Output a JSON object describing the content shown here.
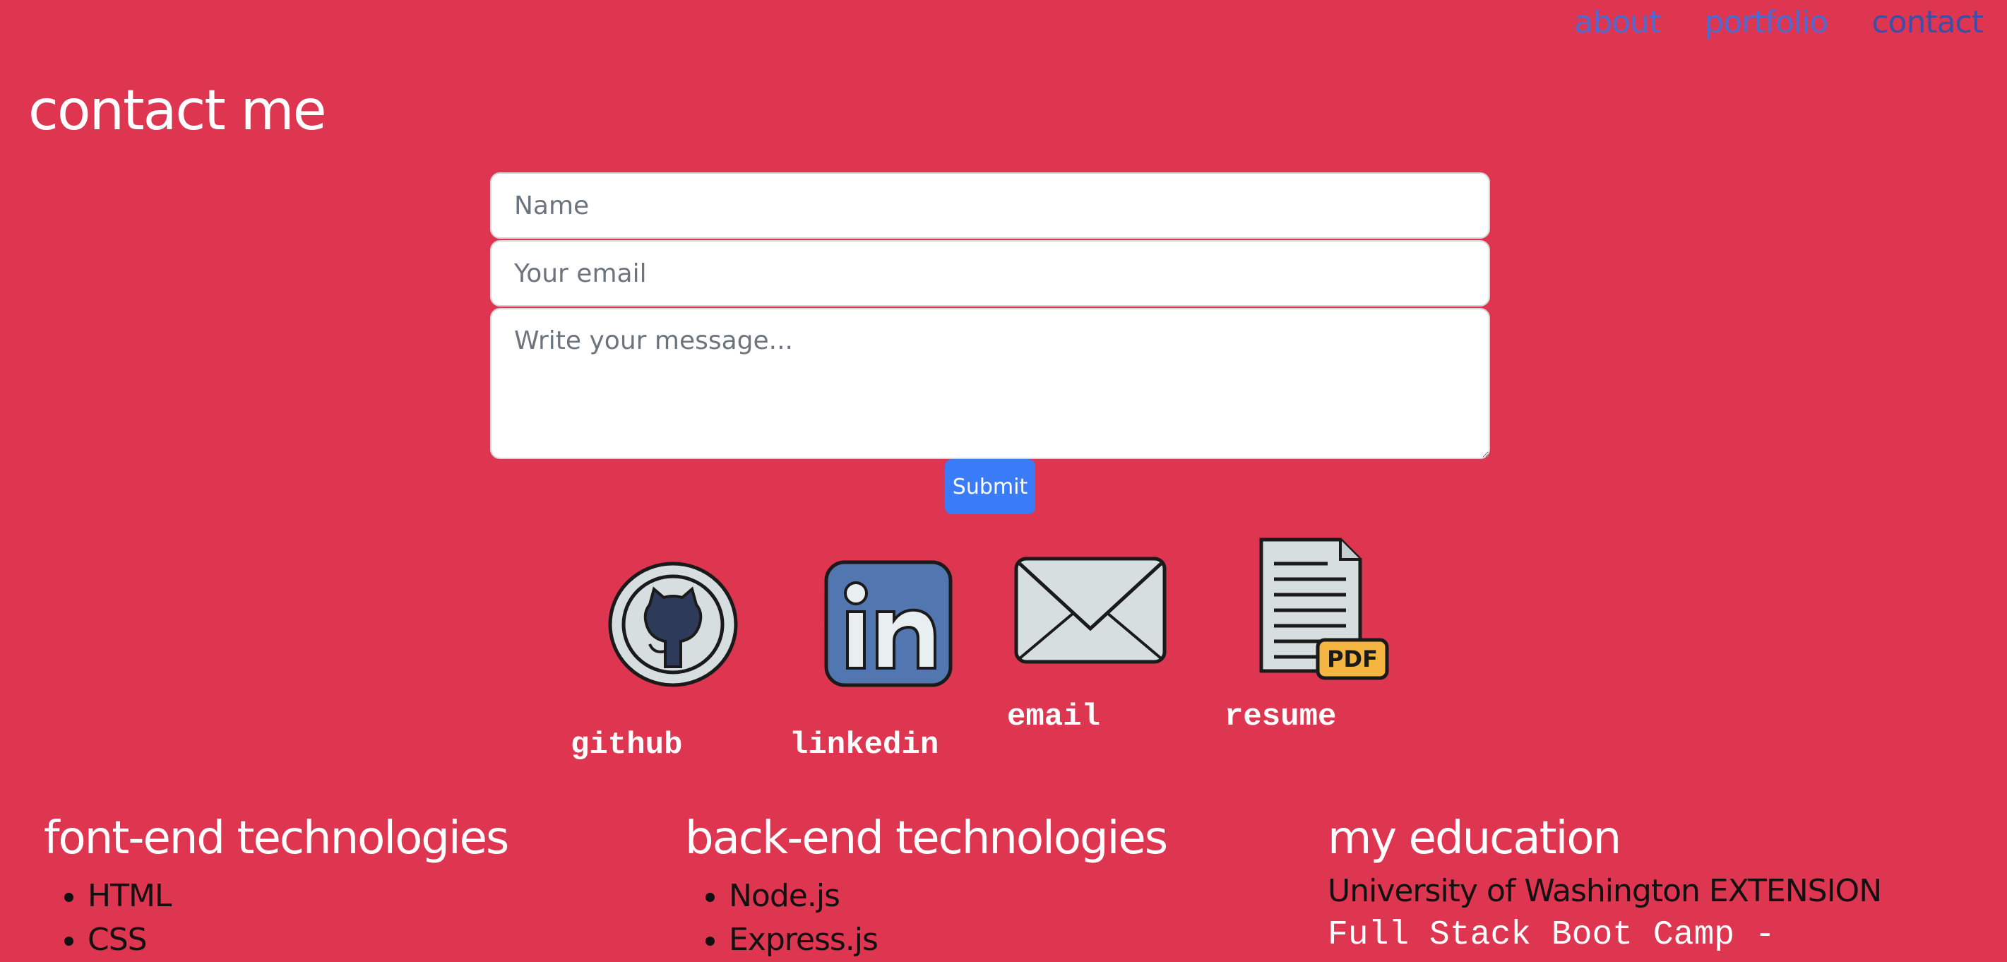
{
  "nav": {
    "items": [
      {
        "label": "about"
      },
      {
        "label": "portfolio"
      },
      {
        "label": "contact"
      }
    ]
  },
  "page": {
    "title": "contact me"
  },
  "form": {
    "name_placeholder": "Name",
    "email_placeholder": "Your email",
    "message_placeholder": "Write your message...",
    "submit_label": "Submit"
  },
  "social": {
    "github": {
      "label": "github",
      "icon": "github-icon"
    },
    "linkedin": {
      "label": "linkedin",
      "icon": "linkedin-icon"
    },
    "email": {
      "label": "email",
      "icon": "envelope-icon"
    },
    "resume": {
      "label": "resume",
      "icon": "pdf-document-icon"
    }
  },
  "sections": {
    "frontend": {
      "title": "font-end technologies",
      "items": [
        "HTML",
        "CSS"
      ]
    },
    "backend": {
      "title": "back-end technologies",
      "items": [
        "Node.js",
        "Express.js"
      ]
    },
    "education": {
      "title": "my education",
      "school": "University of Washington EXTENSION",
      "program": "Full Stack Boot Camp -"
    }
  },
  "colors": {
    "background": "#de3551",
    "nav_link": "#4f6ad0",
    "submit": "#3a7bf7",
    "heading": "#ffffff"
  }
}
